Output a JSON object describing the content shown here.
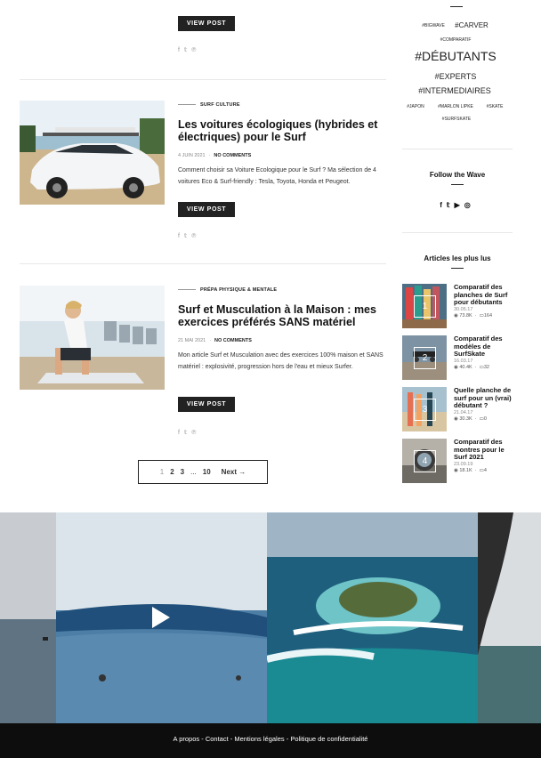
{
  "posts": [
    {
      "view_label": "VIEW POST"
    },
    {
      "category": "SURF CULTURE",
      "title": "Les voitures écologiques (hybrides et électriques) pour le Surf",
      "date": "4 JUIN 2021",
      "comments": "NO COMMENTS",
      "excerpt": "Comment choisir sa Voiture Ecologique pour le Surf ? Ma sélection de 4 voitures Eco & Surf-friendly : Tesla, Toyota, Honda et Peugeot.",
      "view_label": "VIEW POST"
    },
    {
      "category": "PRÉPA PHYSIQUE & MENTALE",
      "title": "Surf et Musculation à la Maison : mes exercices préférés SANS matériel",
      "date": "21 MAI 2021",
      "comments": "NO COMMENTS",
      "excerpt": "Mon article Surf et Musculation avec des exercices 100% maison et SANS matériel : explosivité, progression hors de l'eau et mieux Surfer.",
      "view_label": "VIEW POST"
    }
  ],
  "share_icons": [
    "facebook-icon",
    "twitter-icon",
    "pinterest-icon"
  ],
  "pagination": {
    "pages": [
      "1",
      "2",
      "3",
      "...",
      "10"
    ],
    "next_label": "Next"
  },
  "tags": [
    "#BIGWAVE",
    "#CARVER",
    "#COMPARATIF",
    "#DÉBUTANTS",
    "#EXPERTS",
    "#INTERMEDIAIRES",
    "#JAPON",
    "#MARLON LIPKE",
    "#SKATE",
    "#SURFSKATE"
  ],
  "follow": {
    "title": "Follow the Wave",
    "icons": [
      "facebook-icon",
      "twitter-icon",
      "youtube-icon",
      "instagram-icon"
    ]
  },
  "popular": {
    "title": "Articles les plus lus",
    "items": [
      {
        "num": "1",
        "title": "Comparatif des planches de Surf pour débutants",
        "date": "30.05.17",
        "views": "73.8K",
        "comments": "164"
      },
      {
        "num": "2",
        "title": "Comparatif des modèles de SurfSkate",
        "date": "16.03.17",
        "views": "40.4K",
        "comments": "32"
      },
      {
        "num": "3",
        "title": "Quelle planche de surf pour un (vrai) débutant ?",
        "date": "21.04.17",
        "views": "30.3K",
        "comments": "0"
      },
      {
        "num": "4",
        "title": "Comparatif des montres pour le Surf 2021",
        "date": "23.09.19",
        "views": "18.1K",
        "comments": "4"
      }
    ]
  },
  "footer": {
    "links": [
      "A propos",
      "Contact",
      "Mentions légales",
      "Politique de confidentialité"
    ],
    "separator": " - "
  },
  "colors": {
    "dark": "#222222",
    "footer_bg": "#0d0d0d"
  }
}
